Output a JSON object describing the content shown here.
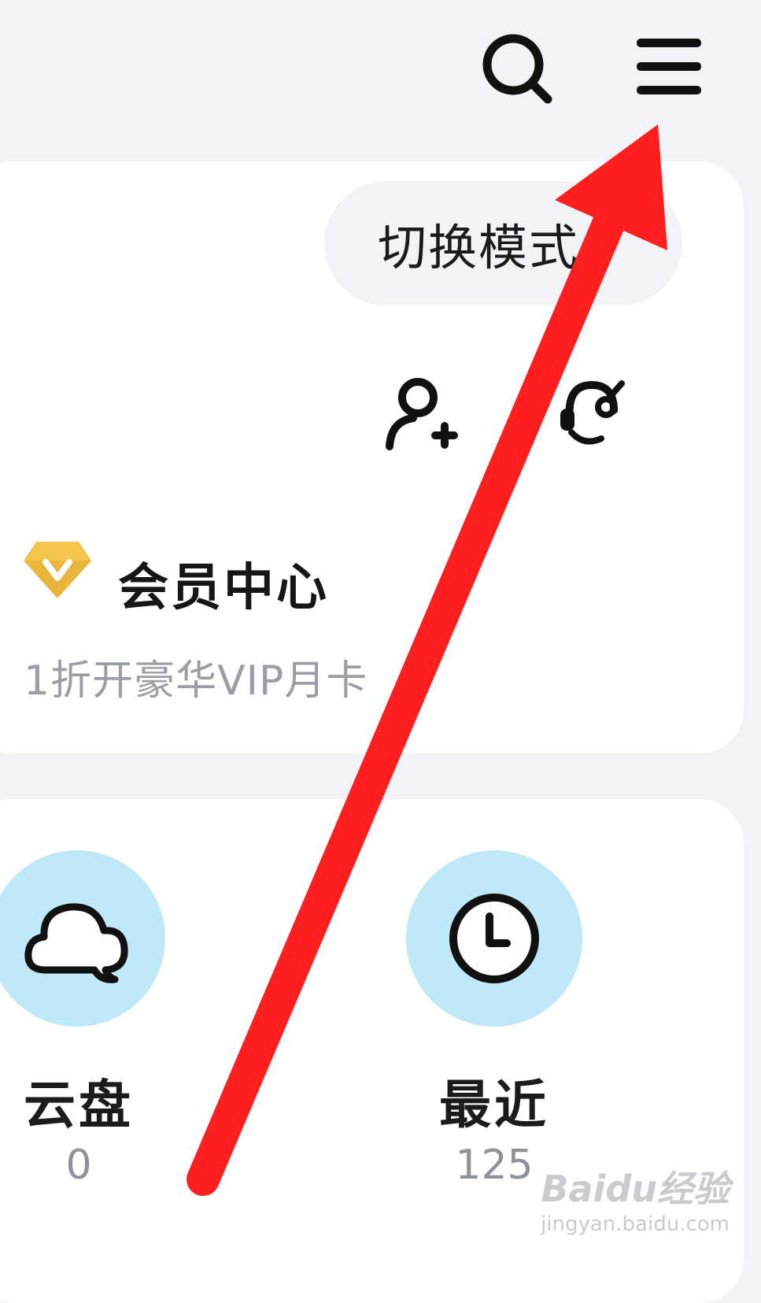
{
  "header": {
    "search_icon": "search-icon",
    "menu_icon": "hamburger-menu-icon"
  },
  "account": {
    "switch_mode_label": "切换模式",
    "add_friend_icon": "add-user-icon",
    "support_icon": "headset-icon"
  },
  "vip": {
    "icon": "diamond-icon",
    "title": "会员中心",
    "subtitle": "1折开豪华VIP月卡",
    "accent": "#f3c64b"
  },
  "quick_entries": [
    {
      "label": "云盘",
      "count": "0",
      "icon": "cloud-icon"
    },
    {
      "label": "最近",
      "count": "125",
      "icon": "clock-icon"
    }
  ],
  "watermark": {
    "brand": "Baidu经验",
    "url": "jingyan.baidu.com"
  },
  "annotation": {
    "arrow_color": "#ff1f1f"
  },
  "colors": {
    "page_bg": "#f2f3f7",
    "card_bg": "#ffffff",
    "entry_circle": "#bfe9f8"
  }
}
